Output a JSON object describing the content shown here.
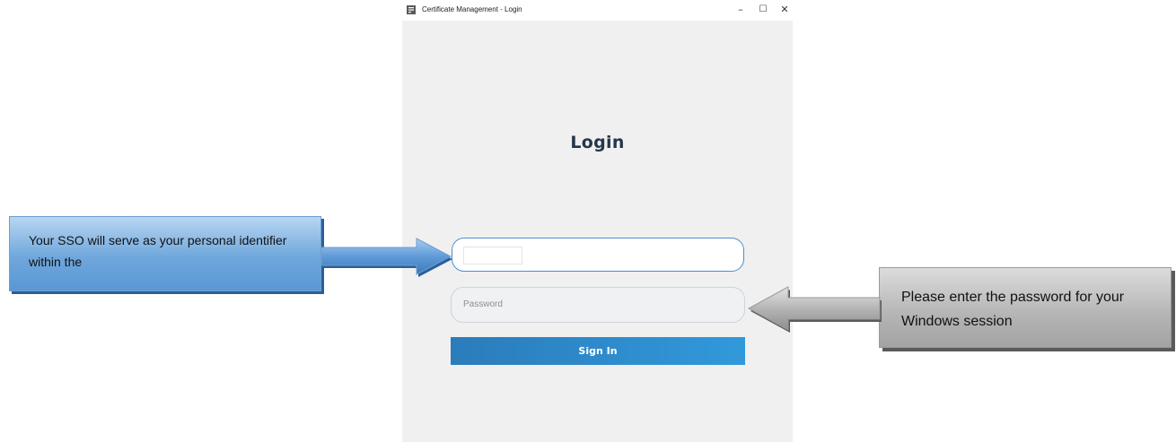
{
  "window": {
    "title": "Certificate Management - Login",
    "controls": {
      "minimize": "–",
      "maximize": "☐",
      "close": "✕"
    }
  },
  "login": {
    "heading": "Login",
    "sso_input": {
      "value": "",
      "placeholder": ""
    },
    "password_input": {
      "value": "",
      "placeholder": "Password"
    },
    "sign_in_label": "Sign In"
  },
  "annotations": {
    "sso_callout": "Your SSO will serve as your personal identifier within the",
    "password_callout": "Please enter the password for your Windows session"
  },
  "colors": {
    "accent": "#3199db",
    "heading": "#24364a",
    "client_background": "#f0f0f0",
    "callout_blue": "#6fa7dc",
    "callout_gray": "#b4b4b4"
  },
  "icons": {
    "app": "certificate-app-icon",
    "sso_arrow": "arrow-right-icon",
    "password_arrow": "arrow-left-icon"
  }
}
